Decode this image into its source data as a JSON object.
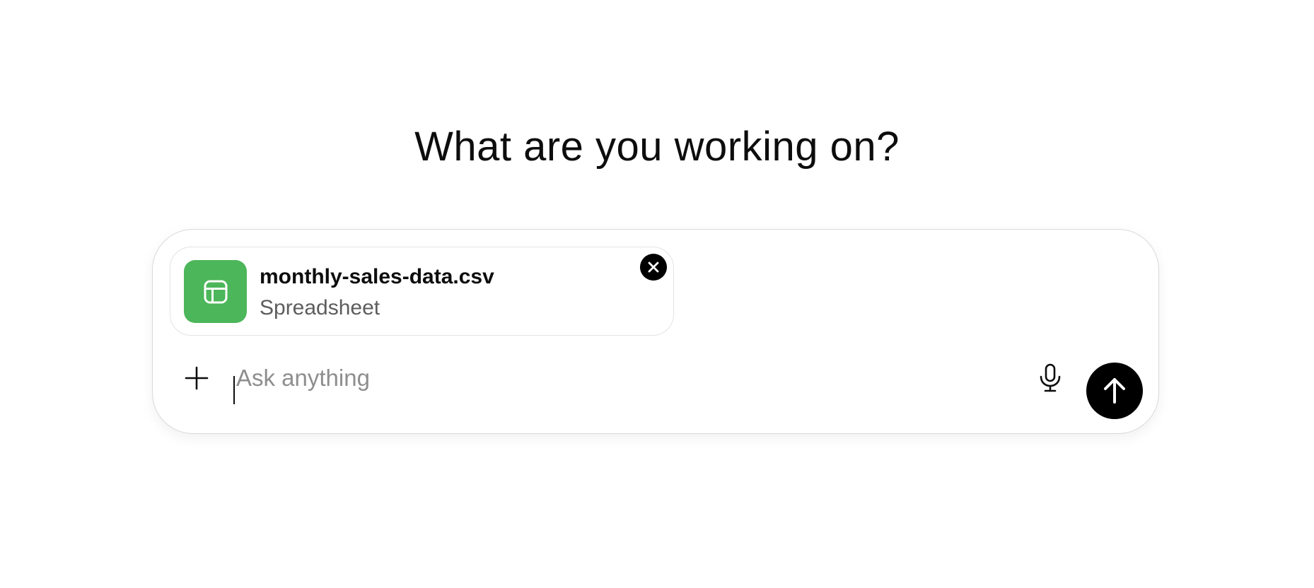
{
  "heading": "What are you working on?",
  "attachment": {
    "file_name": "monthly-sales-data.csv",
    "file_type": "Spreadsheet",
    "icon": "spreadsheet-table-icon",
    "icon_bg_color": "#4cb65a",
    "remove_icon": "close-icon"
  },
  "composer": {
    "placeholder": "Ask anything",
    "value": "",
    "add_icon": "plus-icon",
    "voice_icon": "microphone-icon",
    "send_icon": "arrow-up-icon"
  },
  "colors": {
    "text": "#0d0d0d",
    "placeholder": "#8e8e8e",
    "secondary_text": "#5d5d5d",
    "border": "#d9d9d9",
    "send_button": "#000000"
  }
}
